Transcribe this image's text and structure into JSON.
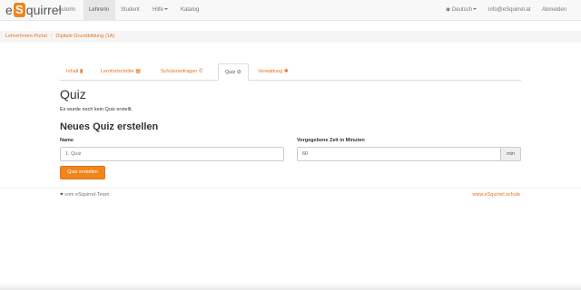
{
  "navbar": {
    "brand_prefix": "e",
    "brand_s": "S",
    "brand_suffix": "quirrel",
    "items": [
      "Autorin",
      "Lehrerin",
      "Student",
      "Hilfe",
      "Katalog"
    ],
    "active_item": "Lehrerin",
    "language": "Deutsch",
    "email": "info@eSquirrel.at",
    "logout": "Abmelden"
  },
  "breadcrumb": {
    "items": [
      "LehrerInnen-Portal",
      "Digitale Grundbildung (1A)"
    ],
    "separator": "/"
  },
  "tabs": [
    {
      "label": "Inhalt",
      "icon": "book-icon",
      "glyph": "▮"
    },
    {
      "label": "Lernfortschritte",
      "icon": "calendar-icon",
      "glyph": "▦"
    },
    {
      "label": "Schüleranfragen",
      "icon": "phone-icon",
      "glyph": "✆"
    },
    {
      "label": "Quiz",
      "icon": "check-circle-icon",
      "glyph": "⊘"
    },
    {
      "label": "Verwaltung",
      "icon": "gear-icon",
      "glyph": "✱"
    }
  ],
  "active_tab": "Quiz",
  "main": {
    "title": "Quiz",
    "no_quiz_message": "Es wurde noch kein Quiz erstellt.",
    "new_quiz_heading": "Neues Quiz erstellen",
    "name_label": "Name",
    "name_placeholder": "1. Quiz",
    "time_label": "Vorgegebene Zeit in Minuten",
    "time_value": "60",
    "time_unit": "min",
    "create_button": "Quiz erstellen"
  },
  "footer": {
    "credit": "vom eSquirrel-Team",
    "heart_icon": "heart-icon",
    "website": "www.eSquirrel.schule"
  },
  "colors": {
    "accent": "#f0851a",
    "link": "#e8711f",
    "navbar_bg": "#f8f8f8"
  }
}
